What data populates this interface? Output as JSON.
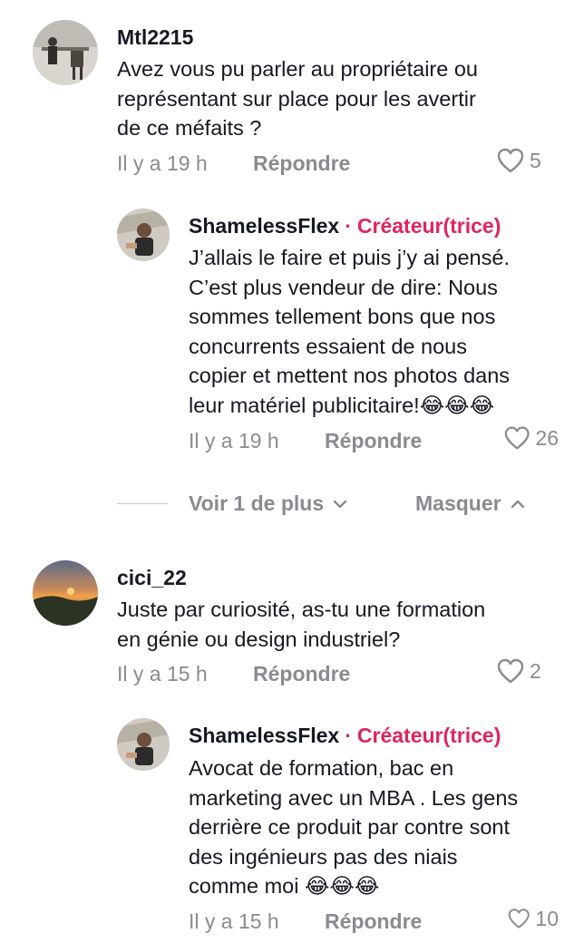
{
  "comments": [
    {
      "username": "Mtl2215",
      "lines": [
        "Avez vous pu parler au propriétaire ou",
        "représentant sur place pour les avertir",
        "de ce méfaits ?"
      ],
      "time": "Il y a 19 h",
      "reply_label": "Répondre",
      "likes": "5",
      "replies": [
        {
          "username": "ShamelessFlex",
          "badge": "Créateur(trice)",
          "lines": [
            "J’allais le faire et puis j’y ai pensé.",
            "C’est plus vendeur de dire: Nous",
            "sommes tellement bons que nos",
            "concurrents essaient de nous",
            "copier et mettent nos photos dans",
            "leur matériel publicitaire!😂😂😂"
          ],
          "time": "Il y a 19 h",
          "reply_label": "Répondre",
          "likes": "26"
        }
      ],
      "view_more": "Voir 1 de plus",
      "hide": "Masquer"
    },
    {
      "username": "cici_22",
      "lines": [
        "Juste par curiosité, as-tu une formation",
        "en génie ou design industriel?"
      ],
      "time": "Il y a 15 h",
      "reply_label": "Répondre",
      "likes": "2",
      "replies": [
        {
          "username": "ShamelessFlex",
          "badge": "Créateur(trice)",
          "lines": [
            "Avocat de formation, bac en",
            "marketing avec un MBA . Les gens",
            "derrière ce produit par contre sont",
            "des ingénieurs pas des niais",
            "comme moi 😂😂😂"
          ],
          "time": "Il y a 15 h",
          "reply_label": "Répondre",
          "likes": "10"
        }
      ]
    }
  ]
}
